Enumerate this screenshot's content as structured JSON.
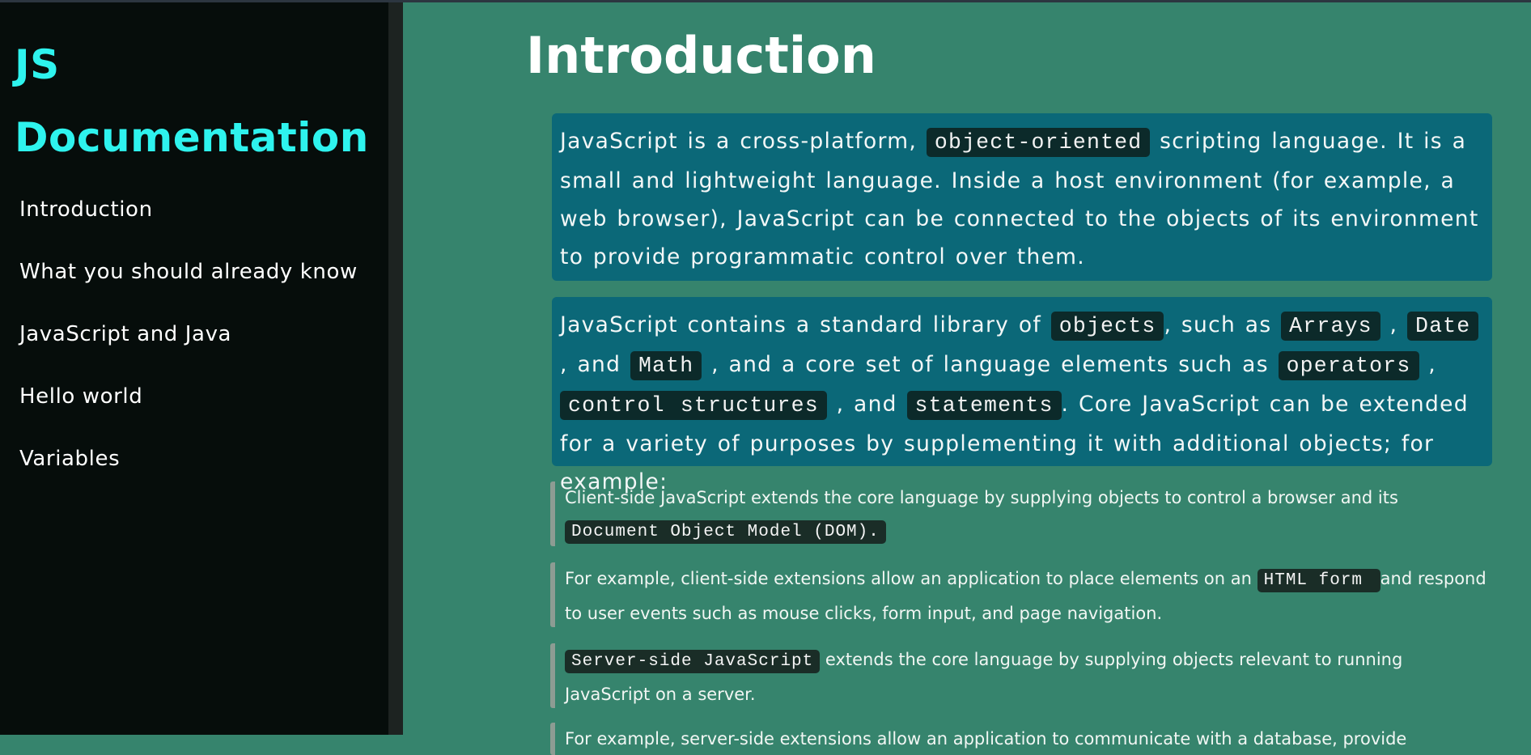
{
  "sidebar": {
    "logo_line1": "JS",
    "logo_line2": "Documentation",
    "nav": [
      "Introduction",
      "What you should already know",
      "JavaScript and Java",
      "Hello world",
      "Variables"
    ]
  },
  "main": {
    "title": "Introduction",
    "p1": {
      "t1": "JavaScript is a cross-platform, ",
      "c1": "object-oriented",
      "t2": " scripting language. It is a small and lightweight language. Inside a host environment (for example, a web browser), JavaScript can be connected to the objects of its environment to provide programmatic control over them."
    },
    "p2": {
      "t1": "JavaScript contains a standard library of ",
      "c1": "objects",
      "t2": ", such as ",
      "c2": "Arrays",
      "t3": " , ",
      "c3": "Date",
      "t4": " , and ",
      "c4": "Math",
      "t5": " , and a core set of language elements such as ",
      "c5": "operators",
      "t6": " , ",
      "c6": "control structures",
      "t7": " , and ",
      "c7": "statements",
      "t8": ". Core JavaScript can be extended for a variety of purposes by supplementing it with additional objects; for example:"
    },
    "notes": {
      "n1_t1": "Client-side JavaScript extends the core language by supplying objects to control a browser and its ",
      "n1_c1": "Document Object Model (DOM).",
      "n2_t1": "For example, client-side extensions allow an application to place elements on an ",
      "n2_c1": "HTML form ",
      "n2_t2": " and respond to user events such as mouse clicks, form input, and page navigation.",
      "n3_c1": "Server-side JavaScript",
      "n3_t1": " extends the core language by supplying objects relevant to running JavaScript on a server.",
      "n4_t1": "For example, server-side extensions allow an application to communicate with a database, provide"
    }
  }
}
